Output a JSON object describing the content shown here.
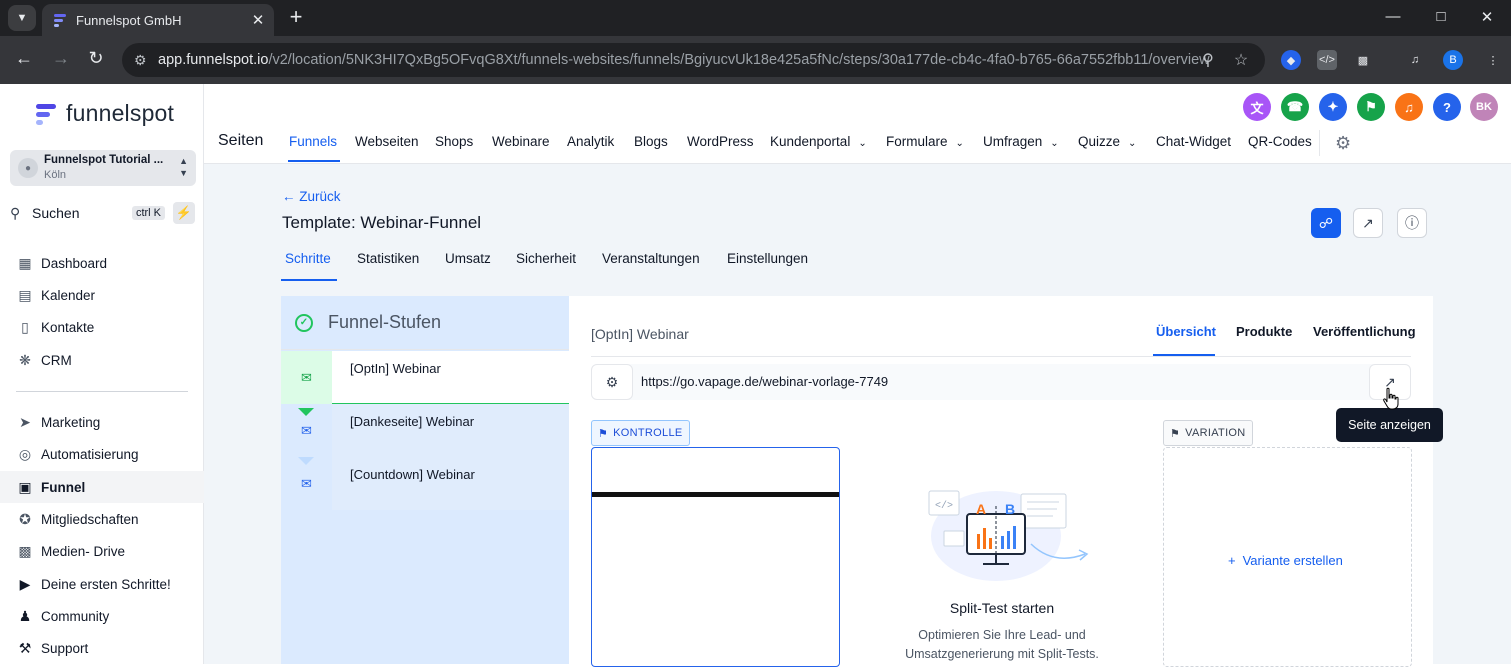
{
  "browser": {
    "tab_title": "Funnelspot GmbH",
    "url_host": "app.funnelspot.io",
    "url_path": "/v2/location/5NK3HI7QxBg5OFvqG8Xt/funnels-websites/funnels/BgiyucvUk18e425a5fNc/steps/30a177de-cb4c-4fa0-b765-66a7552fbb11/overview",
    "profile_initial": "B"
  },
  "sidebar": {
    "brand": "funnelspot",
    "location_name": "Funnelspot Tutorial ...",
    "location_city": "Köln",
    "search_label": "Suchen",
    "search_shortcut": "ctrl K",
    "items": [
      {
        "label": "Dashboard",
        "icon": "dashboard-icon"
      },
      {
        "label": "Kalender",
        "icon": "calendar-icon"
      },
      {
        "label": "Kontakte",
        "icon": "contacts-icon"
      },
      {
        "label": "CRM",
        "icon": "crm-icon"
      },
      {
        "label": "Marketing",
        "icon": "send-icon"
      },
      {
        "label": "Automatisierung",
        "icon": "automation-icon"
      },
      {
        "label": "Funnel",
        "icon": "funnel-icon"
      },
      {
        "label": "Mitgliedschaften",
        "icon": "badge-icon"
      },
      {
        "label": "Medien- Drive",
        "icon": "image-icon"
      },
      {
        "label": "Deine ersten Schritte!",
        "icon": "play-icon"
      },
      {
        "label": "Community",
        "icon": "community-icon"
      },
      {
        "label": "Support",
        "icon": "wrench-icon"
      }
    ]
  },
  "header": {
    "section_title": "Seiten",
    "tabs": [
      "Funnels",
      "Webseiten",
      "Shops",
      "Webinare",
      "Analytik",
      "Blogs",
      "WordPress",
      "Kundenportal",
      "Formulare",
      "Umfragen",
      "Quizze",
      "Chat-Widget",
      "QR-Codes"
    ],
    "user_initials": "BK"
  },
  "page": {
    "back_label": "Zurück",
    "title": "Template: Webinar-Funnel",
    "tabs": [
      "Schritte",
      "Statistiken",
      "Umsatz",
      "Sicherheit",
      "Veranstaltungen",
      "Einstellungen"
    ]
  },
  "funnel_steps": {
    "title": "Funnel-Stufen",
    "steps": [
      "[OptIn] Webinar",
      "[Dankeseite] Webinar",
      "[Countdown] Webinar"
    ]
  },
  "detail": {
    "step_name": "[OptIn] Webinar",
    "tabs": [
      "Übersicht",
      "Produkte",
      "Veröffentlichung"
    ],
    "url": "https://go.vapage.de/webinar-vorlage-7749",
    "tooltip": "Seite anzeigen",
    "control_label": "KONTROLLE",
    "variation_label": "VARIATION",
    "create_variant": "Variante erstellen",
    "split_title": "Split-Test starten",
    "split_desc": "Optimieren Sie Ihre Lead- und Umsatzgenerierung mit Split-Tests.",
    "illus_a": "A",
    "illus_b": "B"
  },
  "colors": {
    "accent": "#155eef",
    "success": "#22c55e",
    "steps_bg": "#dbeafe"
  }
}
